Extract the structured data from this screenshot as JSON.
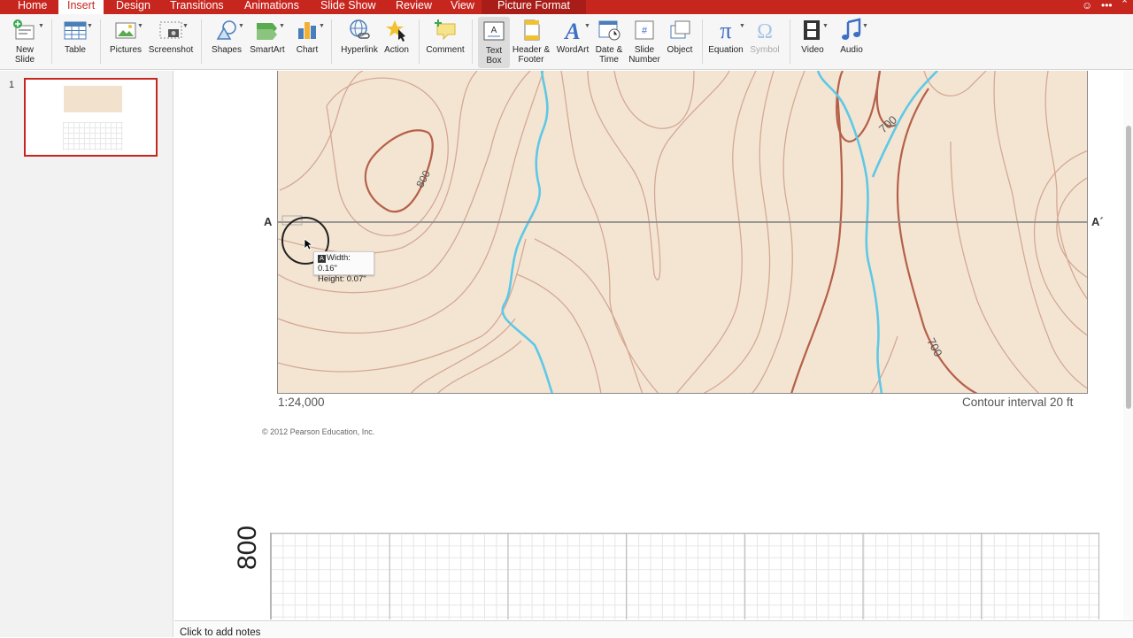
{
  "tabs": [
    {
      "label": "Home"
    },
    {
      "label": "Insert"
    },
    {
      "label": "Design"
    },
    {
      "label": "Transitions"
    },
    {
      "label": "Animations"
    },
    {
      "label": "Slide Show"
    },
    {
      "label": "Review"
    },
    {
      "label": "View"
    },
    {
      "label": "Picture Format"
    }
  ],
  "ribbon": {
    "new_slide": "New\nSlide",
    "table": "Table",
    "pictures": "Pictures",
    "screenshot": "Screenshot",
    "shapes": "Shapes",
    "smartart": "SmartArt",
    "chart": "Chart",
    "hyperlink": "Hyperlink",
    "action": "Action",
    "comment": "Comment",
    "text_box": "Text\nBox",
    "header_footer": "Header &\nFooter",
    "wordart": "WordArt",
    "date_time": "Date &\nTime",
    "slide_number": "Slide\nNumber",
    "object": "Object",
    "equation": "Equation",
    "symbol": "Symbol",
    "video": "Video",
    "audio": "Audio"
  },
  "slide_panel": {
    "slide_number": "1"
  },
  "map": {
    "label_a": "A",
    "label_a_prime": "A´",
    "scale": "1:24,000",
    "contour_interval": "Contour interval 20 ft",
    "copyright": "© 2012 Pearson Education, Inc.",
    "contour_labels": [
      "800",
      "700",
      "700"
    ]
  },
  "size_tooltip": {
    "badge": "A",
    "width": "Width: 0.16\"",
    "height": "Height: 0.07\""
  },
  "profile": {
    "elevation_label": "800"
  },
  "notes": {
    "placeholder": "Click to add notes"
  },
  "colors": {
    "tab_bar": "#c7261f",
    "map_fill": "#f4e5d3",
    "contour": "#c9907a",
    "index_contour": "#b5604a",
    "stream": "#5ec8e6",
    "selected_border": "#c7261f"
  }
}
